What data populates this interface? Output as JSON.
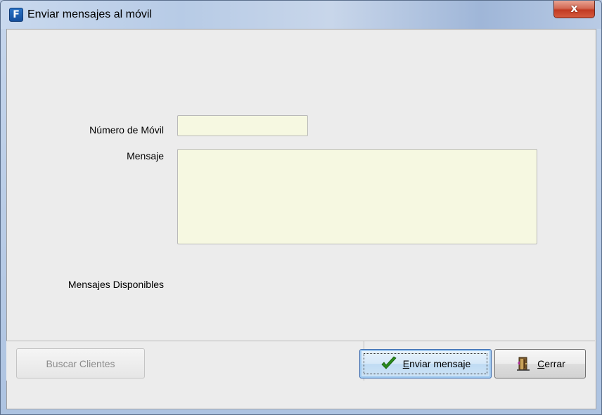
{
  "window": {
    "title": "Enviar mensajes al móvil",
    "close_glyph": "x",
    "app_icon_glyph": "F"
  },
  "form": {
    "phone_label": "Número de Móvil",
    "phone_value": "",
    "message_label": "Mensaje",
    "message_value": "",
    "available_label": "Mensajes Disponibles"
  },
  "buttons": {
    "search_clients": {
      "label": "Buscar Clientes",
      "enabled": false
    },
    "send_message": {
      "accel": "E",
      "label_rest": "nviar mensaje",
      "icon": "checkmark-icon"
    },
    "close": {
      "accel": "C",
      "label_rest": "errar",
      "icon": "door-exit-icon"
    }
  },
  "colors": {
    "field_background": "#f6f8e1",
    "close_button": "#c13a22",
    "checkmark": "#2a8a1c"
  }
}
